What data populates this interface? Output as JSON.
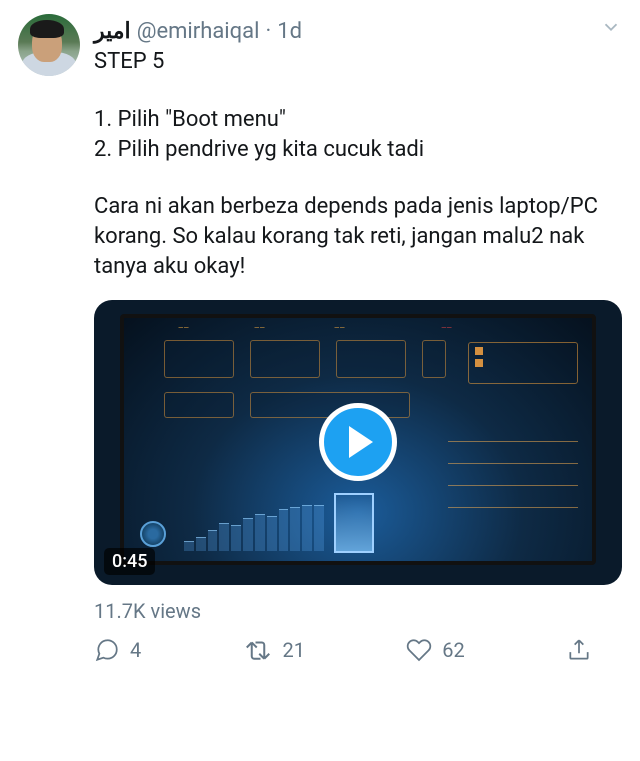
{
  "tweet": {
    "author": {
      "display_name": "امير",
      "handle": "@emirhaiqal",
      "time": "1d"
    },
    "body": {
      "title": "STEP 5",
      "items": [
        "1. Pilih \"Boot menu\"",
        "2. Pilih pendrive yg kita cucuk tadi"
      ],
      "para": "Cara ni akan berbeza depends pada jenis laptop/PC korang. So kalau korang tak reti, jangan malu2 nak tanya aku okay!"
    },
    "media": {
      "duration": "0:45",
      "views": "11.7K views"
    },
    "actions": {
      "reply_count": "4",
      "retweet_count": "21",
      "like_count": "62"
    }
  },
  "icons": {
    "chevron": "chevron-down-icon",
    "play": "play-icon",
    "reply": "reply-icon",
    "retweet": "retweet-icon",
    "like": "like-icon",
    "share": "share-icon"
  }
}
